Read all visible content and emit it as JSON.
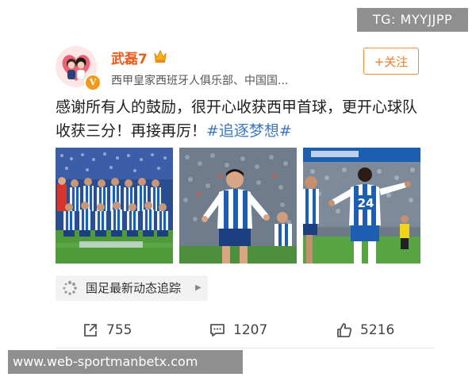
{
  "watermark_top": "TG: MYYJJPP",
  "watermark_bottom": "www.web-sportmanbetx.com",
  "post": {
    "author": "武磊7",
    "author_desc": "西甲皇家西班牙人俱乐部、中国国...",
    "follow_label": "+关注",
    "verified_mark": "V",
    "text_main": "感谢所有人的鼓励，很开心收获西甲首球，更开心球队收获三分！再接再厉！",
    "hashtag": "#追逐梦想#"
  },
  "topic": {
    "label": "国足最新动态追踪",
    "arrow": "▶"
  },
  "actions": {
    "repost_count": "755",
    "comment_count": "1207",
    "like_count": "5216"
  },
  "colors": {
    "author_name": "#f05a1a",
    "hashtag": "#3b78c4",
    "follow_border": "#f08a3a",
    "verified": "#f49a1b",
    "watermark_bg": "#8f8f8f",
    "espanyol_blue": "#1c5fb0"
  }
}
